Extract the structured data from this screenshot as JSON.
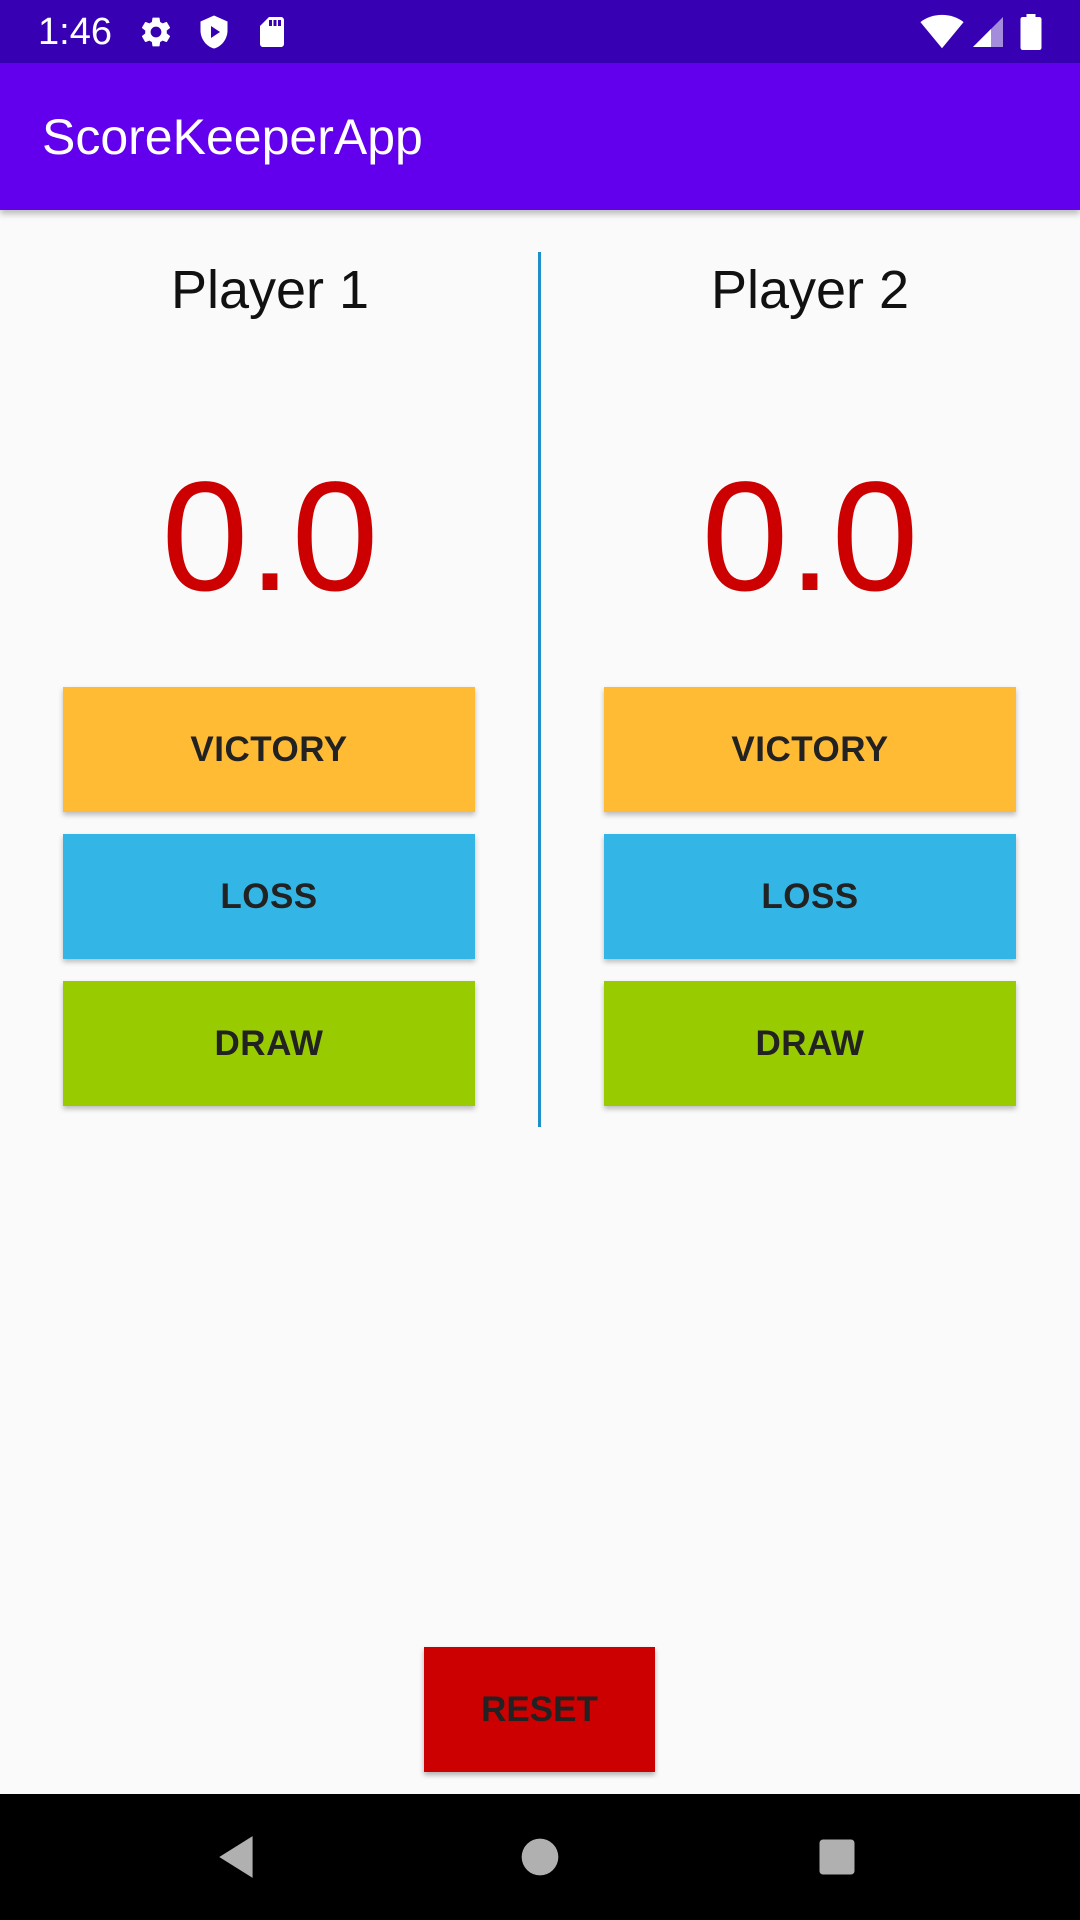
{
  "status_bar": {
    "time": "1:46",
    "left_icons": [
      "settings-icon",
      "shield-icon",
      "sd-card-icon"
    ],
    "right_icons": [
      "wifi-icon",
      "cellular-signal-icon",
      "battery-icon"
    ]
  },
  "app_bar": {
    "title": "ScoreKeeperApp"
  },
  "players": [
    {
      "name": "Player 1",
      "score": "0.0",
      "buttons": {
        "victory": "VICTORY",
        "loss": "LOSS",
        "draw": "DRAW"
      }
    },
    {
      "name": "Player 2",
      "score": "0.0",
      "buttons": {
        "victory": "VICTORY",
        "loss": "LOSS",
        "draw": "DRAW"
      }
    }
  ],
  "reset_label": "RESET",
  "colors": {
    "status_bar": "#3700B3",
    "app_bar": "#6200EE",
    "score": "#CC0000",
    "victory": "#FFBB33",
    "loss": "#33B5E5",
    "draw": "#99CC00",
    "reset": "#CC0000",
    "divider": "#1E8FC8"
  },
  "nav_bar": {
    "icons": [
      "back-icon",
      "home-icon",
      "recents-icon"
    ]
  }
}
